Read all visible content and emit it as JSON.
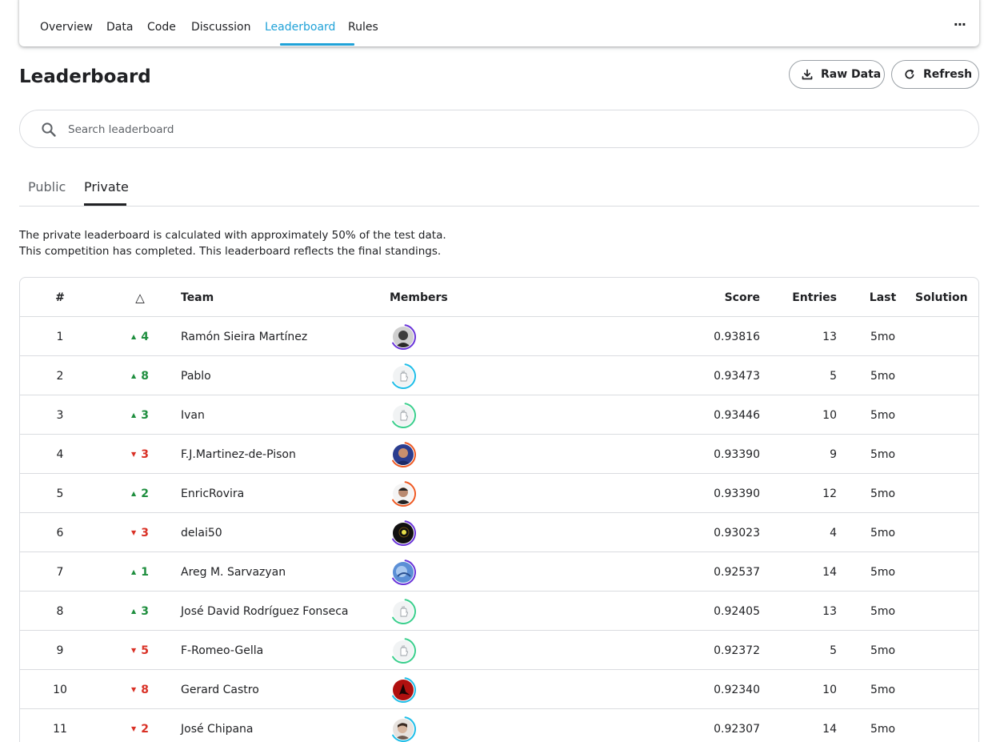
{
  "nav": {
    "tabs": [
      {
        "label": "Overview"
      },
      {
        "label": "Data"
      },
      {
        "label": "Code"
      },
      {
        "label": "Discussion"
      },
      {
        "label": "Leaderboard"
      },
      {
        "label": "Rules"
      }
    ],
    "active_tab": "Leaderboard",
    "more_label": "···",
    "accent_color": "#20a2d8"
  },
  "page": {
    "title": "Leaderboard",
    "raw_data_label": "Raw Data",
    "refresh_label": "Refresh"
  },
  "search": {
    "placeholder": "Search leaderboard",
    "value": ""
  },
  "subtabs": {
    "public_label": "Public",
    "private_label": "Private",
    "active": "Private"
  },
  "description": {
    "line1": "The private leaderboard is calculated with approximately 50% of the test data.",
    "line2": "This competition has completed. This leaderboard reflects the final standings."
  },
  "table": {
    "headers": {
      "rank": "#",
      "delta": "△",
      "team": "Team",
      "members": "Members",
      "score": "Score",
      "entries": "Entries",
      "last": "Last",
      "solution": "Solution"
    },
    "rows": [
      {
        "rank": "1",
        "direction": "up",
        "delta": "4",
        "team": "Ramón Sieira Martínez",
        "score": "0.93816",
        "entries": "13",
        "last": "5mo",
        "avatar": "photo-gray",
        "ring_color": "#6a35d9"
      },
      {
        "rank": "2",
        "direction": "up",
        "delta": "8",
        "team": "Pablo",
        "score": "0.93473",
        "entries": "5",
        "last": "5mo",
        "avatar": "default-hand",
        "ring_color": "#20bee8"
      },
      {
        "rank": "3",
        "direction": "up",
        "delta": "3",
        "team": "Ivan",
        "score": "0.93446",
        "entries": "10",
        "last": "5mo",
        "avatar": "default-hand",
        "ring_color": "#3ccf8e"
      },
      {
        "rank": "4",
        "direction": "down",
        "delta": "3",
        "team": "F.J.Martinez-de-Pison",
        "score": "0.93390",
        "entries": "9",
        "last": "5mo",
        "avatar": "photo-blue",
        "ring_color": "#ee5a24"
      },
      {
        "rank": "5",
        "direction": "up",
        "delta": "2",
        "team": "EnricRovira",
        "score": "0.93390",
        "entries": "12",
        "last": "5mo",
        "avatar": "photo-face",
        "ring_color": "#ee5a24"
      },
      {
        "rank": "6",
        "direction": "down",
        "delta": "3",
        "team": "delai50",
        "score": "0.93023",
        "entries": "4",
        "last": "5mo",
        "avatar": "photo-dark",
        "ring_color": "#6a35d9"
      },
      {
        "rank": "7",
        "direction": "up",
        "delta": "1",
        "team": "Areg M. Sarvazyan",
        "score": "0.92537",
        "entries": "14",
        "last": "5mo",
        "avatar": "photo-sky",
        "ring_color": "#6a35d9"
      },
      {
        "rank": "8",
        "direction": "up",
        "delta": "3",
        "team": "José David Rodríguez Fonseca",
        "score": "0.92405",
        "entries": "13",
        "last": "5mo",
        "avatar": "default-hand",
        "ring_color": "#3ccf8e"
      },
      {
        "rank": "9",
        "direction": "down",
        "delta": "5",
        "team": "F-Romeo-Gella",
        "score": "0.92372",
        "entries": "5",
        "last": "5mo",
        "avatar": "default-hand",
        "ring_color": "#3ccf8e"
      },
      {
        "rank": "10",
        "direction": "down",
        "delta": "8",
        "team": "Gerard Castro",
        "score": "0.92340",
        "entries": "10",
        "last": "5mo",
        "avatar": "photo-red",
        "ring_color": "#20bee8"
      },
      {
        "rank": "11",
        "direction": "down",
        "delta": "2",
        "team": "José Chipana",
        "score": "0.92307",
        "entries": "14",
        "last": "5mo",
        "avatar": "photo-face-light",
        "ring_color": "#20bee8"
      }
    ]
  },
  "colors": {
    "up": "#1e8e3e",
    "down": "#d93025",
    "border": "#dadce0"
  }
}
